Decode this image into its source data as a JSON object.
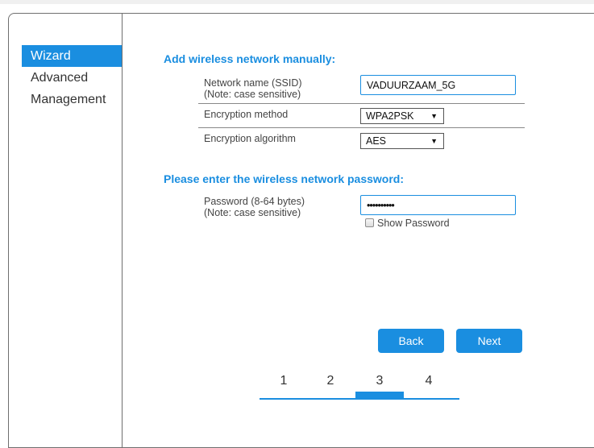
{
  "sidebar": {
    "items": [
      {
        "label": "Wizard",
        "active": true
      },
      {
        "label": "Advanced",
        "active": false
      },
      {
        "label": "Management",
        "active": false
      }
    ]
  },
  "manual": {
    "title": "Add wireless network manually:",
    "ssid_label_1": "Network name (SSID)",
    "ssid_label_2": "(Note: case sensitive)",
    "ssid_value": "VADUURZAAM_5G",
    "encryption_method_label": "Encryption method",
    "encryption_method_value": "WPA2PSK",
    "encryption_algorithm_label": "Encryption algorithm",
    "encryption_algorithm_value": "AES"
  },
  "password_section": {
    "title": "Please enter the wireless network password:",
    "label_1": "Password (8-64 bytes)",
    "label_2": "(Note: case sensitive)",
    "masked_value": "••••••••••",
    "show_password_label": "Show Password",
    "show_password_checked": false
  },
  "buttons": {
    "back": "Back",
    "next": "Next"
  },
  "steps": {
    "items": [
      "1",
      "2",
      "3",
      "4"
    ],
    "current": "3"
  },
  "colors": {
    "accent": "#1a8ee0",
    "border": "#6f6f6f"
  },
  "icons": {
    "dropdown": "caret-down-icon"
  }
}
